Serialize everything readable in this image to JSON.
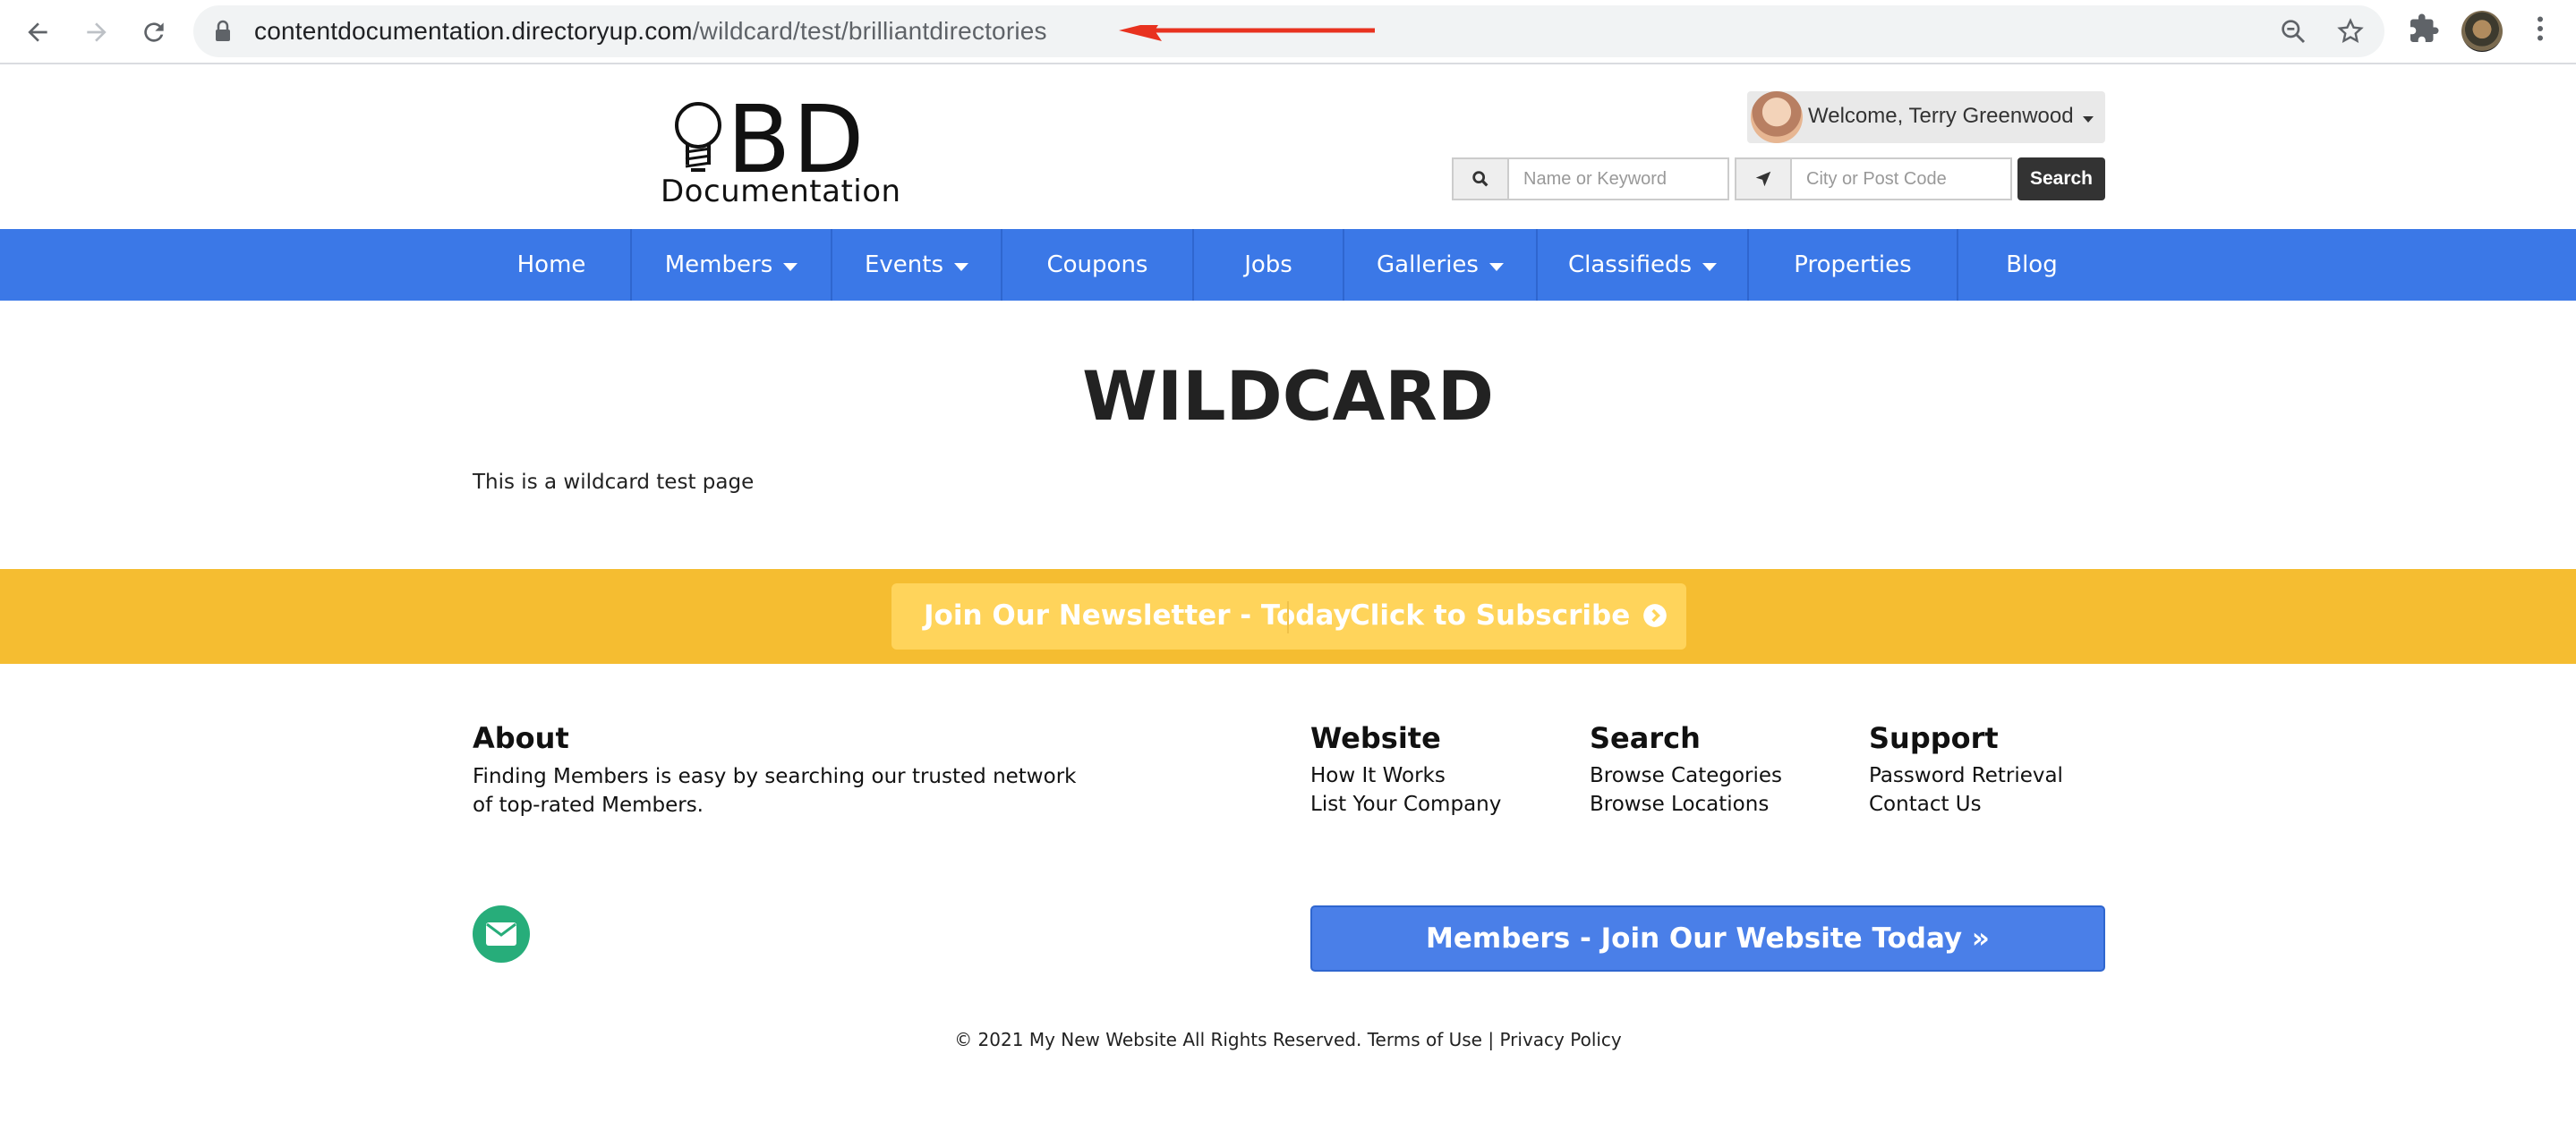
{
  "browser": {
    "url_host": "contentdocumentation.directoryup.com",
    "url_path": "/wildcard/test/brilliantdirectories",
    "icons": [
      "back-arrow-icon",
      "forward-arrow-icon",
      "reload-icon",
      "lock-icon",
      "zoom-icon",
      "star-icon",
      "extensions-icon",
      "profile-avatar",
      "menu-dots-icon"
    ]
  },
  "site": {
    "logo_letters": "BD",
    "logo_word": "Documentation",
    "welcome": "Welcome, Terry Greenwood",
    "search": {
      "keyword_placeholder": "Name or Keyword",
      "location_placeholder": "City or Post Code",
      "button": "Search"
    }
  },
  "nav": {
    "items": [
      {
        "label": "Home",
        "dropdown": false
      },
      {
        "label": "Members",
        "dropdown": true
      },
      {
        "label": "Events",
        "dropdown": true
      },
      {
        "label": "Coupons",
        "dropdown": false
      },
      {
        "label": "Jobs",
        "dropdown": false
      },
      {
        "label": "Galleries",
        "dropdown": true
      },
      {
        "label": "Classifieds",
        "dropdown": true
      },
      {
        "label": "Properties",
        "dropdown": false
      },
      {
        "label": "Blog",
        "dropdown": false
      }
    ]
  },
  "page": {
    "title": "WILDCARD",
    "body": "This is a wildcard test page"
  },
  "newsletter": {
    "left": "Join Our Newsletter - Today",
    "right": "Click to Subscribe"
  },
  "footer": {
    "about": {
      "heading": "About",
      "text": "Finding Members is easy by searching our trusted network of top-rated Members."
    },
    "website": {
      "heading": "Website",
      "links": [
        "How It Works",
        "List Your Company"
      ]
    },
    "search": {
      "heading": "Search",
      "links": [
        "Browse Categories",
        "Browse Locations"
      ]
    },
    "support": {
      "heading": "Support",
      "links": [
        "Password Retrieval",
        "Contact Us"
      ]
    },
    "join_button": "Members - Join Our Website Today »",
    "copyright": "© 2021 My New Website All Rights Reserved.",
    "terms": "Terms of Use",
    "separator": "|",
    "privacy": "Privacy Policy"
  },
  "colors": {
    "nav_blue": "#3b78e7",
    "newsletter_yellow": "#f5bd31",
    "mail_green": "#27ad7a",
    "join_blue": "#4a7fe8",
    "annotation_red": "#e8321f"
  }
}
